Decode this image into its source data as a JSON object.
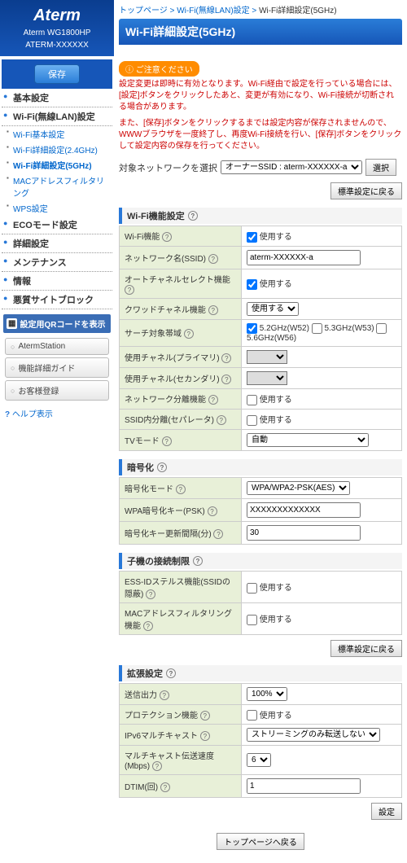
{
  "logo": "Aterm",
  "model1": "Aterm WG1800HP",
  "model2": "ATERM-XXXXXX",
  "save": "保存",
  "bc": {
    "a": "トップページ",
    "b": "Wi-Fi(無線LAN)設定",
    "c": "Wi-Fi詳細設定(5GHz)"
  },
  "title": "Wi-Fi詳細設定(5GHz)",
  "warn_badge": "ご注意ください",
  "warn1": "設定変更は即時に有効となります。Wi-Fi経由で設定を行っている場合には、[設定]ボタンをクリックしたあと、変更が有効になり、Wi-Fi接続が切断される場合があります。",
  "warn2": "また、[保存]ボタンをクリックするまでは設定内容が保存されませんので、WWWブラウザを一度終了し、再度Wi-Fi接続を行い、[保存]ボタンをクリックして設定内容の保存を行ってください。",
  "target_label": "対象ネットワークを選択",
  "target_value": "オーナーSSID : aterm-XXXXXX-a",
  "select_btn": "選択",
  "reset_btn": "標準設定に戻る",
  "nav": {
    "basic": "基本設定",
    "wifi": "Wi-Fi(無線LAN)設定",
    "s1": "Wi-Fi基本設定",
    "s2": "Wi-Fi詳細設定(2.4GHz)",
    "s3": "Wi-Fi詳細設定(5GHz)",
    "s4": "MACアドレスフィルタリング",
    "s5": "WPS設定",
    "eco": "ECOモード設定",
    "detail": "詳細設定",
    "maint": "メンテナンス",
    "info": "情報",
    "block": "悪質サイトブロック"
  },
  "qr": "設定用QRコードを表示",
  "sb1": "AtermStation",
  "sb2": "機能詳細ガイド",
  "sb3": "お客様登録",
  "help": "ヘルプ表示",
  "sec_wifi": "Wi-Fi機能設定",
  "sec_crypto": "暗号化",
  "sec_child": "子機の接続制限",
  "sec_ext": "拡張設定",
  "use": "使用する",
  "f": {
    "wifi_func": "Wi-Fi機能",
    "ssid": "ネットワーク名(SSID)",
    "ssid_v": "aterm-XXXXXX-a",
    "auto_ch": "オートチャネルセレクト機能",
    "quad": "クワッドチャネル機能",
    "quad_v": "使用する",
    "band": "サーチ対象帯域",
    "band1": "5.2GHz(W52)",
    "band2": "5.3GHz(W53)",
    "band3": "5.6GHz(W56)",
    "ch1": "使用チャネル(プライマリ)",
    "ch2": "使用チャネル(セカンダリ)",
    "iso": "ネットワーク分離機能",
    "sep": "SSID内分離(セパレータ)",
    "tv": "TVモード",
    "tv_v": "自動",
    "cmode": "暗号化モード",
    "cmode_v": "WPA/WPA2-PSK(AES)",
    "psk": "WPA暗号化キー(PSK)",
    "psk_v": "XXXXXXXXXXXXX",
    "intv": "暗号化キー更新間隔(分)",
    "intv_v": "30",
    "ess": "ESS-IDステルス機能(SSIDの隠蔽)",
    "mac": "MACアドレスフィルタリング機能",
    "tx": "送信出力",
    "tx_v": "100%",
    "prot": "プロテクション機能",
    "ipv6": "IPv6マルチキャスト",
    "ipv6_v": "ストリーミングのみ転送しない",
    "mcast": "マルチキャスト伝送速度(Mbps)",
    "mcast_v": "6",
    "dtim": "DTIM(回)",
    "dtim_v": "1"
  },
  "set_btn": "設定",
  "top_btn": "トップページへ戻る"
}
